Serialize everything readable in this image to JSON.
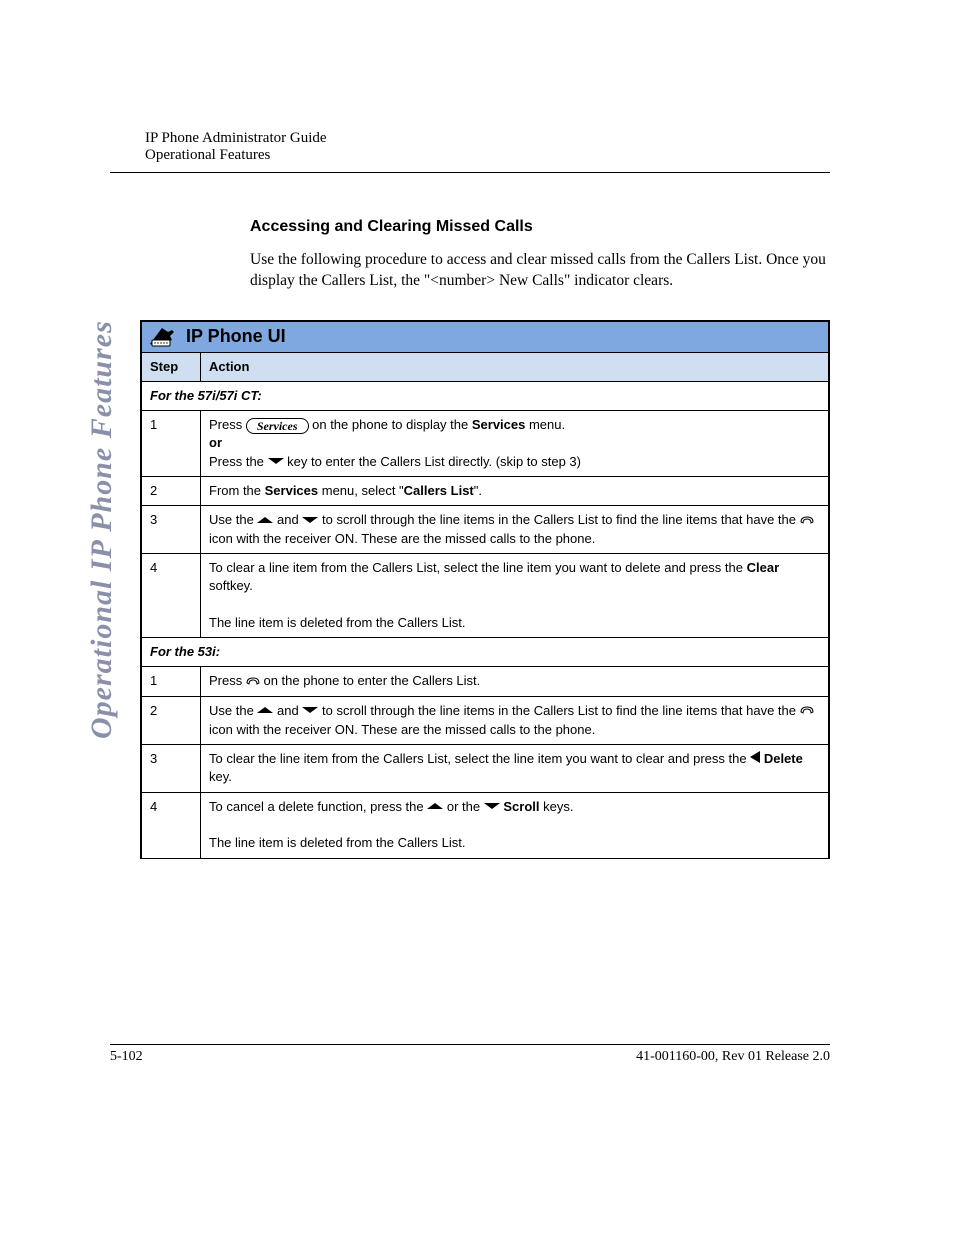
{
  "header": {
    "line1": "IP Phone Administrator Guide",
    "line2": "Operational Features"
  },
  "side_tab": "Operational IP Phone Features",
  "section_title": "Accessing and Clearing Missed Calls",
  "intro": "Use the following procedure to access and clear missed calls from the Callers List. Once you display the Callers List, the \"<number> New Calls\" indicator clears.",
  "panel_title": "IP Phone UI",
  "columns": {
    "step": "Step",
    "action": "Action"
  },
  "sub1": "For the 57i/57i CT:",
  "sub2": "For the 53i:",
  "s57": {
    "1": {
      "pre": "Press ",
      "key": "Services",
      "post": " on the phone to display the ",
      "b1": "Services",
      "tail": " menu.",
      "or": "or",
      "line2a": "Press the ",
      "line2b": " key to enter the Callers List directly. (skip to step 3)"
    },
    "2": {
      "a": "From the ",
      "b": "Services",
      "c": " menu, select \"",
      "d": "Callers List",
      "e": "\"."
    },
    "3": {
      "a": "Use the ",
      "b": " and ",
      "c": " to scroll through the line items in the Callers List to find the line items that have the ",
      "d": " icon with the receiver ON. These are the missed calls to the phone."
    },
    "4": {
      "a": "To clear a line item from the Callers List, select the line item you want to delete and press the ",
      "b": "Clear",
      "c": " softkey.",
      "d": "The line item is deleted from the Callers List."
    }
  },
  "s53": {
    "1": {
      "a": "Press ",
      "b": " on the phone to enter the Callers List."
    },
    "2": {
      "a": "Use the ",
      "b": " and ",
      "c": " to scroll through the line items in the Callers List to find the line items that have the ",
      "d": " icon with the receiver ON. These are the missed calls to the phone."
    },
    "3": {
      "a": "To clear the line item from the Callers List, select the line item you want to clear and press the ",
      "b": "Delete",
      "c": " key."
    },
    "4": {
      "a": "To cancel a delete function, press the ",
      "b": " or the ",
      "c": "Scroll",
      "d": " keys.",
      "e": "The line item is deleted from the Callers List."
    }
  },
  "footer": {
    "left": "5-102",
    "right": "41-001160-00, Rev 01 Release 2.0"
  }
}
